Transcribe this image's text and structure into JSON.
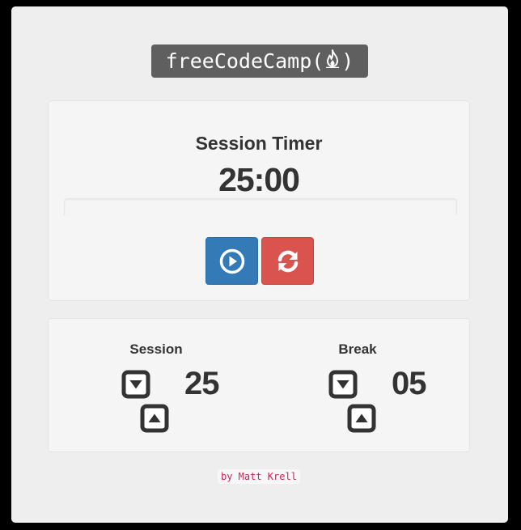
{
  "logo": {
    "text_before": "freeCodeCamp(",
    "text_after": ")",
    "icon": "fire-icon"
  },
  "timer": {
    "title": "Session Timer",
    "display": "25:00",
    "progress_fraction": 0
  },
  "controls": {
    "play_icon": "play-circle-icon",
    "reset_icon": "refresh-icon",
    "play_color": "#337ab7",
    "reset_color": "#d9534f"
  },
  "settings": {
    "session": {
      "label": "Session",
      "value": "25",
      "decrement_icon": "caret-square-down-icon",
      "increment_icon": "caret-square-up-icon"
    },
    "break": {
      "label": "Break",
      "value": "05",
      "decrement_icon": "caret-square-down-icon",
      "increment_icon": "caret-square-up-icon"
    }
  },
  "footer": {
    "credit": "by Matt Krell"
  }
}
